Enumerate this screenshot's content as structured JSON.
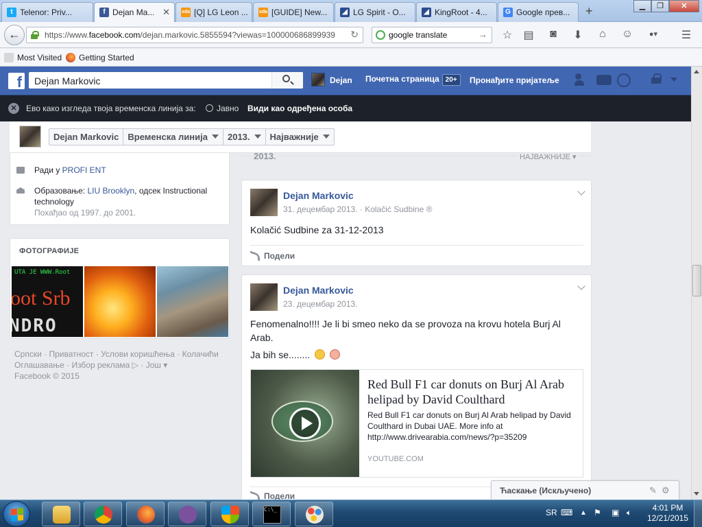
{
  "browser": {
    "tabs": [
      {
        "label": "Telenor: Priv...",
        "icon": "telenor-icon",
        "color": "#19aaf8"
      },
      {
        "label": "Dejan Ma...",
        "icon": "facebook-icon",
        "color": "#3b5998"
      },
      {
        "label": "[Q] LG Leon ...",
        "icon": "xda-icon",
        "color": "#f59714"
      },
      {
        "label": "[GUIDE] New...",
        "icon": "xda-icon",
        "color": "#f59714"
      },
      {
        "label": "LG Spirit - O...",
        "icon": "lg-icon",
        "color": "#2b4c8c"
      },
      {
        "label": "KingRoot - 4...",
        "icon": "kingroot-icon",
        "color": "#2b4c8c"
      },
      {
        "label": "Google прев...",
        "icon": "google-translate-icon",
        "color": "#4285f4"
      }
    ],
    "new_tab": "+",
    "url_prefix": "https://www.",
    "url_domain": "facebook.com",
    "url_rest": "/dejan.markovic.5855594?viewas=100000686899939",
    "search_text": "google translate",
    "bookmarks": [
      "Most Visited",
      "Getting Started"
    ],
    "window_controls": {
      "minimize": "▁",
      "maximize": "❐",
      "close": "✕"
    }
  },
  "fb": {
    "search_value": "Dejan Markovic",
    "nav_user": "Dejan",
    "nav_home": "Почетна страница",
    "home_badge": "20+",
    "nav_find_friends": "Пронађите пријатеље",
    "accent": "#4267b2"
  },
  "viewas": {
    "prefix": "Ево како изгледа твоја временска линија за:",
    "audience": "Јавно",
    "link": "Види као одређена особа"
  },
  "sticky": {
    "name": "Dejan Markovic",
    "timeline": "Временска линија",
    "year": "2013.",
    "highlights": "Најважније"
  },
  "timeline_header": {
    "year": "2013.",
    "filter": "НАЈВАЖНИЈЕ ▾"
  },
  "intro": {
    "work_prefix": "Ради у ",
    "work_link": "PROFI ENT",
    "edu_prefix": "Образовање: ",
    "edu_link": "LIU Brooklyn",
    "edu_rest": ", одсек Instructional technology",
    "edu_years": "Похађао од 1997. до 2001."
  },
  "photos": {
    "title": "ФОТОГРАФИЈЕ",
    "photo1_lines": [
      "UTA JE WWW.Root",
      "oot Srb",
      "NDRO"
    ]
  },
  "footer": {
    "links": [
      "Српски",
      "Приватност",
      "Услови коришћења",
      "Колачићи",
      "Оглашавање",
      "Избор реклама",
      "Још"
    ],
    "copyright": "Facebook © 2015"
  },
  "posts": [
    {
      "author": "Dejan Markovic",
      "date": "31. децембар 2013.",
      "app": "Kolačić Sudbine ®",
      "text": "Kolačić Sudbine za 31-12-2013",
      "share": "Подели"
    },
    {
      "author": "Dejan Markovic",
      "date": "23. децембар 2013.",
      "text": "Fenomenalno!!!! Je li bi smeo neko da se provoza na krovu hotela Burj Al Arab.",
      "text2": "Ja bih se........",
      "link_title": "Red Bull F1 car donuts on Burj Al Arab helipad by David Coulthard",
      "link_desc": "Red Bull F1 car donuts on Burj Al Arab helipad by David Coulthard in Dubai UAE. More info at http://www.drivearabia.com/news/?p=35209",
      "link_domain": "YOUTUBE.COM",
      "share": "Подели"
    }
  ],
  "chat": {
    "label": "Ћаскање (Искључено)"
  },
  "taskbar": {
    "apps": [
      "file-explorer-icon",
      "chrome-icon",
      "firefox-icon",
      "viber-icon",
      "security-shield-icon",
      "command-prompt-icon",
      "paint-icon"
    ],
    "language": "SR",
    "time": "4:01 PM",
    "date": "12/21/2015"
  }
}
